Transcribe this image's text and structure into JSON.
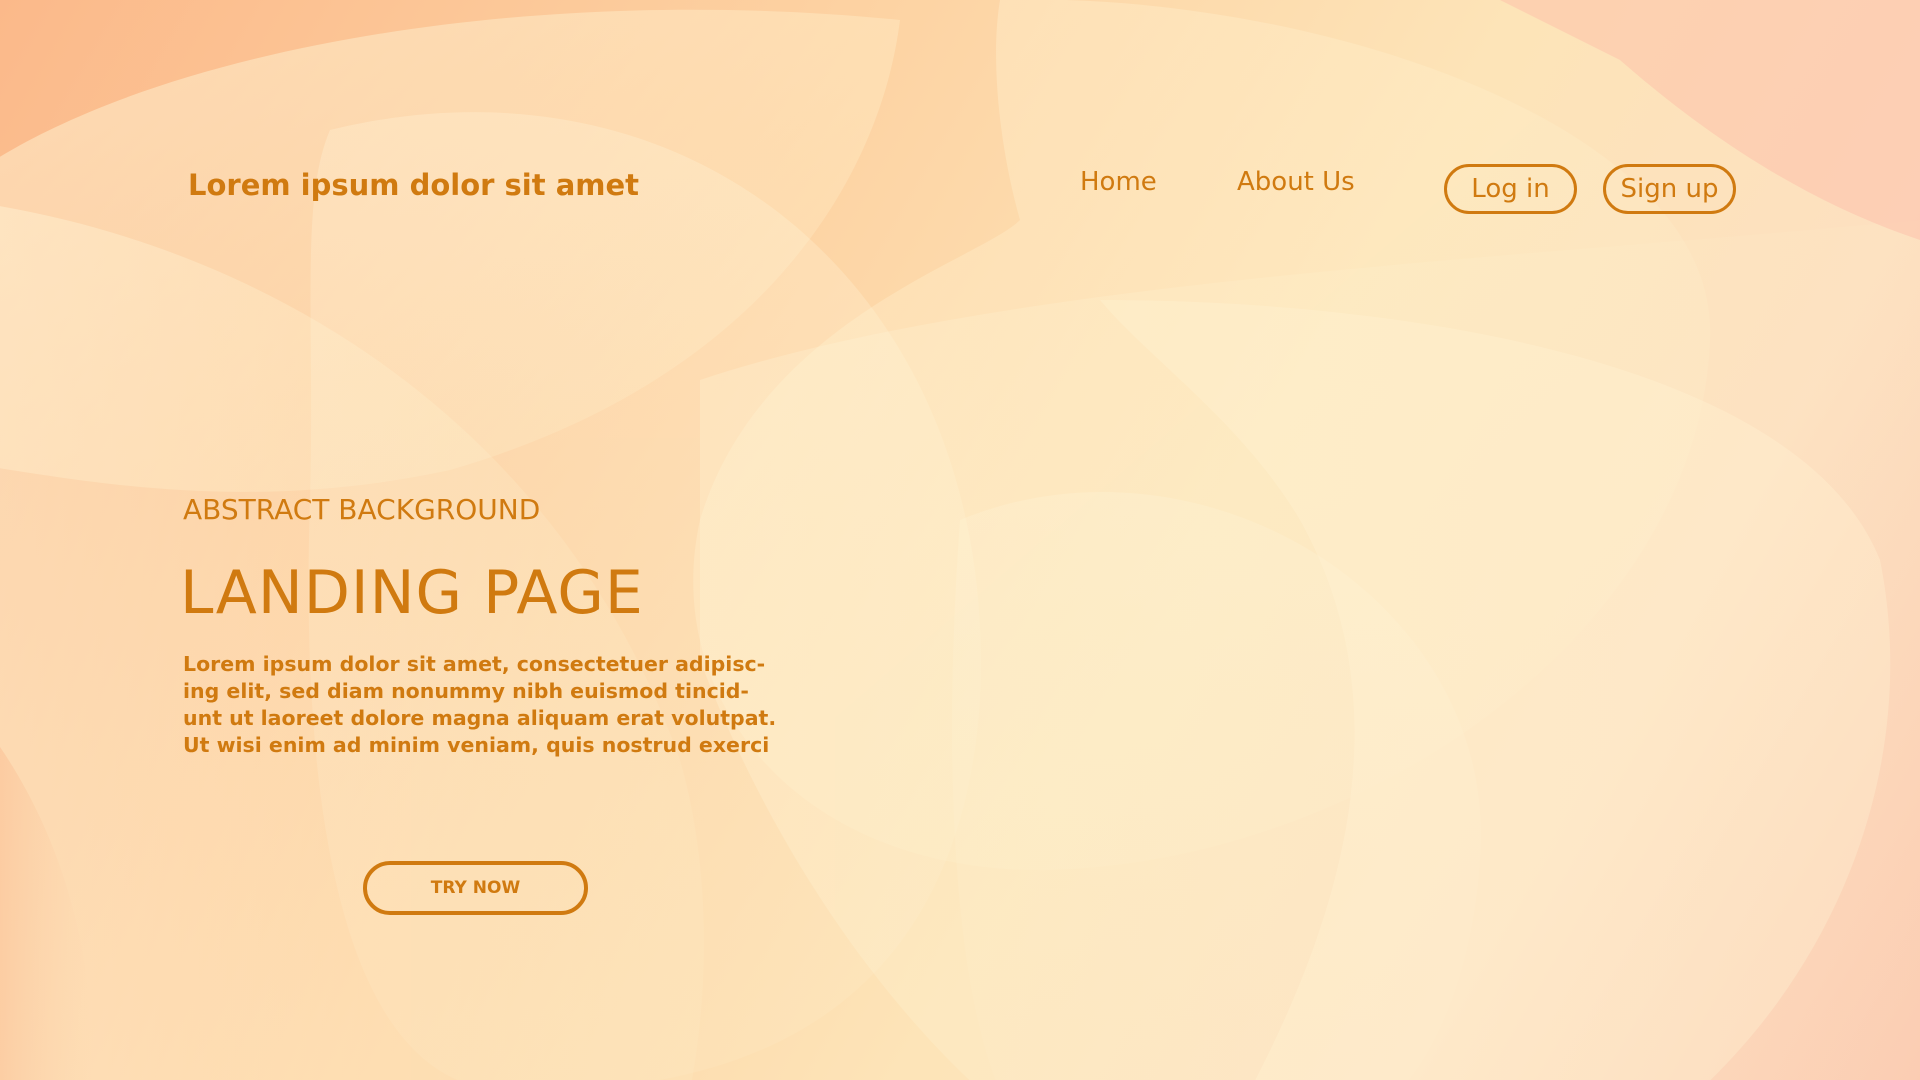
{
  "header": {
    "brand": "Lorem ipsum dolor sit amet",
    "nav": {
      "home": "Home",
      "about": "About Us"
    },
    "login_label": "Log in",
    "signup_label": "Sign up"
  },
  "hero": {
    "eyebrow": "ABSTRACT BACKGROUND",
    "title": "LANDING PAGE",
    "body_lines": [
      "Lorem ipsum dolor sit amet, consectetuer adipisc-",
      "ing elit, sed diam nonummy nibh euismod tincid-",
      "unt ut laoreet dolore magna aliquam erat volutpat.",
      "Ut wisi enim ad minim veniam, quis nostrud exerci"
    ],
    "cta_label": "TRY NOW"
  },
  "colors": {
    "accent": "#d07a10",
    "background_start": "#fbb98a",
    "background_end": "#fde4b8"
  }
}
